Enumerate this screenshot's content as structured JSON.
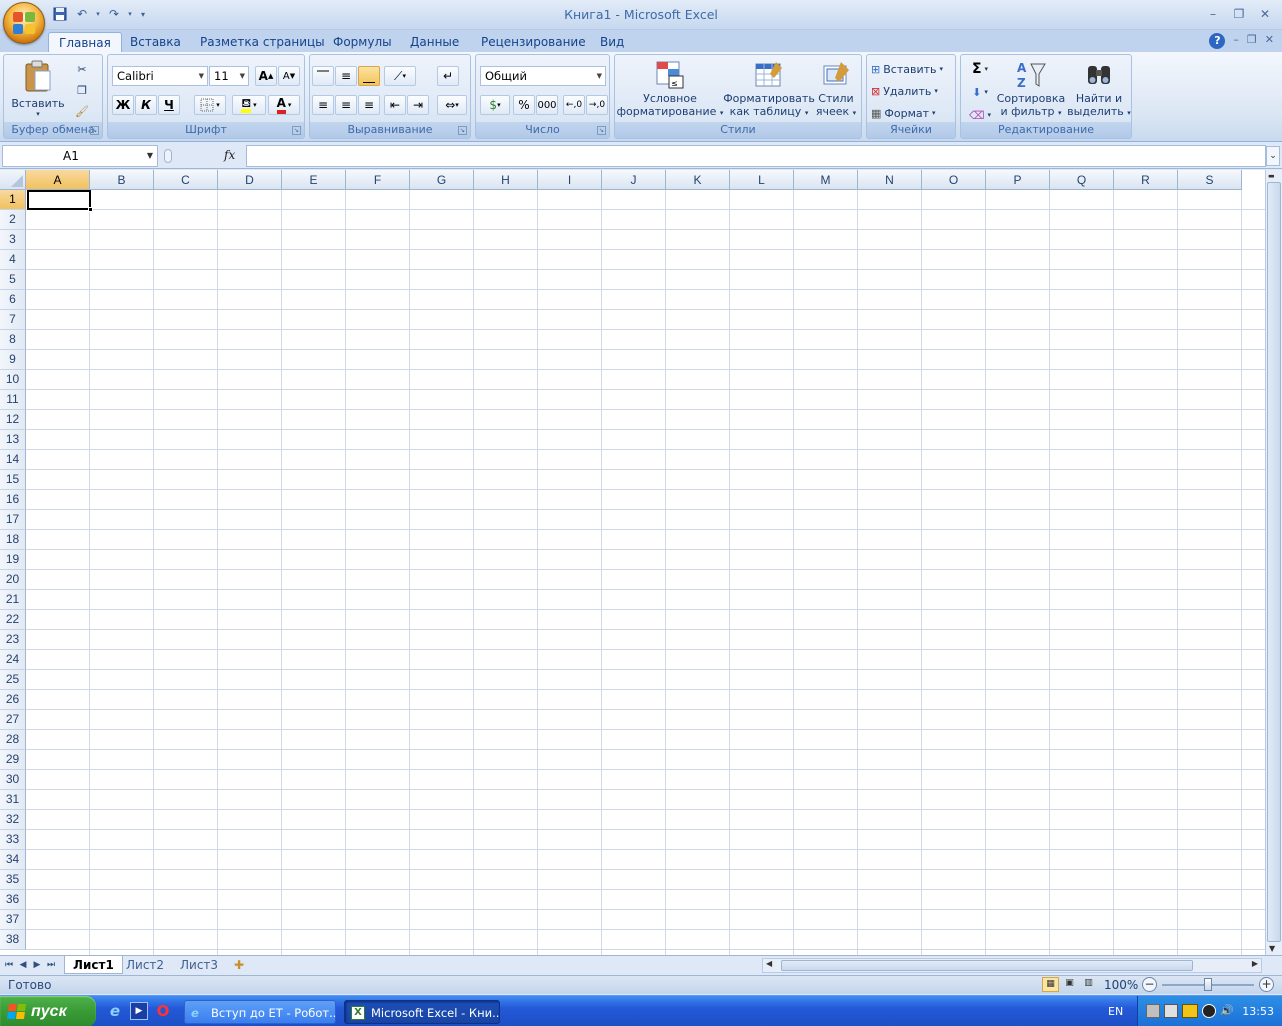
{
  "window": {
    "title": "Книга1 - Microsoft Excel"
  },
  "ribbon": {
    "tabs": [
      "Главная",
      "Вставка",
      "Разметка страницы",
      "Формулы",
      "Данные",
      "Рецензирование",
      "Вид"
    ],
    "active_tab": "Главная",
    "clipboard": {
      "paste_label": "Вставить",
      "group_label": "Буфер обмена"
    },
    "font": {
      "font_name": "Calibri",
      "font_size": "11",
      "bold": "Ж",
      "italic": "К",
      "underline": "Ч",
      "group_label": "Шрифт"
    },
    "alignment": {
      "group_label": "Выравнивание"
    },
    "number": {
      "format": "Общий",
      "percent": "%",
      "thousands": "000",
      "group_label": "Число"
    },
    "styles": {
      "conditional_line1": "Условное",
      "conditional_line2": "форматирование",
      "table_line1": "Форматировать",
      "table_line2": "как таблицу",
      "cell_styles_line1": "Стили",
      "cell_styles_line2": "ячеек",
      "group_label": "Стили"
    },
    "cells": {
      "insert": "Вставить",
      "delete": "Удалить",
      "format": "Формат",
      "group_label": "Ячейки"
    },
    "editing": {
      "sum_symbol": "Σ",
      "sort_line1": "Сортировка",
      "sort_line2": "и фильтр",
      "find_line1": "Найти и",
      "find_line2": "выделить",
      "group_label": "Редактирование"
    }
  },
  "formula_bar": {
    "name_box": "A1",
    "fx": "fx",
    "formula": ""
  },
  "grid": {
    "columns": [
      "A",
      "B",
      "C",
      "D",
      "E",
      "F",
      "G",
      "H",
      "I",
      "J",
      "K",
      "L",
      "M",
      "N",
      "O",
      "P",
      "Q",
      "R",
      "S"
    ],
    "rows": [
      "1",
      "2",
      "3",
      "4",
      "5",
      "6",
      "7",
      "8",
      "9",
      "10",
      "11",
      "12",
      "13",
      "14",
      "15",
      "16",
      "17",
      "18",
      "19",
      "20",
      "21",
      "22",
      "23",
      "24",
      "25",
      "26",
      "27",
      "28",
      "29",
      "30",
      "31",
      "32",
      "33",
      "34",
      "35",
      "36",
      "37",
      "38"
    ],
    "selected_cell": "A1"
  },
  "sheets": {
    "tabs": [
      "Лист1",
      "Лист2",
      "Лист3"
    ],
    "active": "Лист1"
  },
  "status": {
    "ready": "Готово",
    "zoom": "100%"
  },
  "taskbar": {
    "start": "пуск",
    "buttons": [
      "Вступ до ЕТ - Робот...",
      "Microsoft Excel - Кни..."
    ],
    "lang": "EN",
    "time": "13:53"
  },
  "colors": {
    "ribbon_bg": "#dbe6f4",
    "selected_header": "#f1c15f",
    "gridline": "#d0d7e5",
    "taskbar": "#2459d8",
    "start_green": "#3a9b36"
  }
}
